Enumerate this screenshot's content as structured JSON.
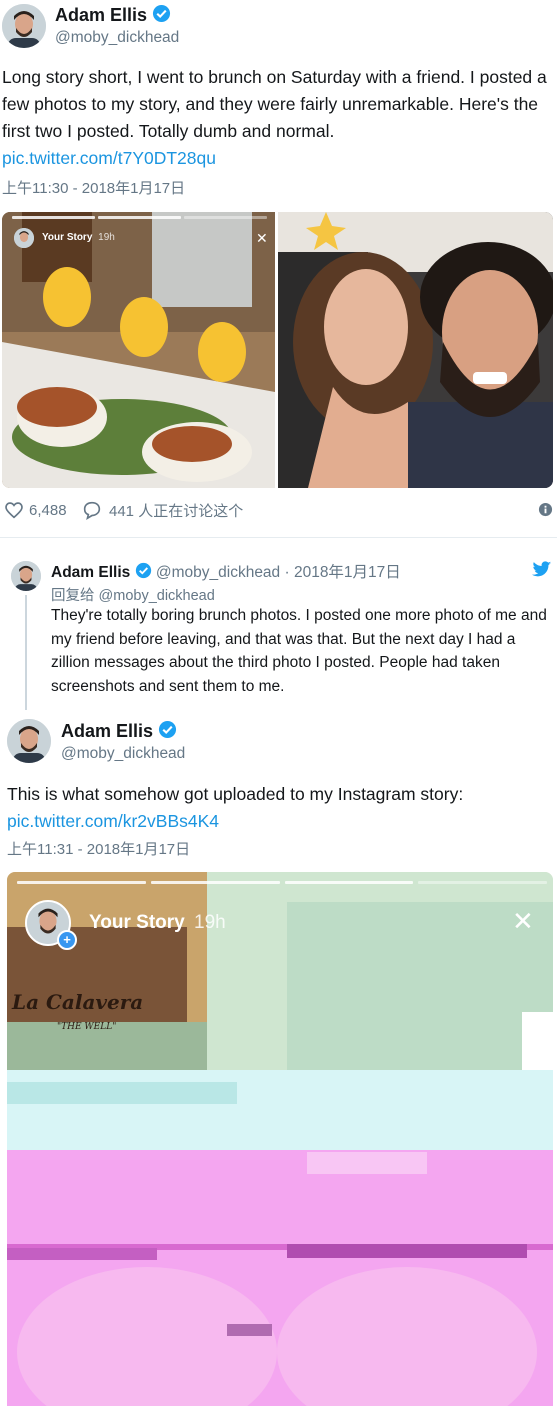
{
  "tweet1": {
    "display_name": "Adam Ellis",
    "handle": "@moby_dickhead",
    "text": "Long story short, I went to brunch on Saturday with a friend. I posted a few photos to my story, and they were fairly unremarkable. Here's the first two I posted. Totally dumb and normal.",
    "link": "pic.twitter.com/t7Y0DT28qu",
    "timestamp": "上午11:30 - 2018年1月17日",
    "story_label": "Your Story",
    "story_age": "19h",
    "likes": "6,488",
    "replies": "441 人正在讨论这个"
  },
  "reply": {
    "display_name": "Adam Ellis",
    "handle_date": "@moby_dickhead · 2018年1月17日",
    "reply_to": "回复给 @moby_dickhead",
    "text": "They're totally boring brunch photos. I posted one more photo of me and my friend before leaving, and that was that. But the next day I had a zillion messages about the third photo I posted. People had taken screenshots and sent them to me."
  },
  "tweet2": {
    "display_name": "Adam Ellis",
    "handle": "@moby_dickhead",
    "text": "This is what somehow got uploaded to my Instagram story:",
    "link": "pic.twitter.com/kr2vBBs4K4",
    "timestamp": "上午11:31 - 2018年1月17日",
    "story_label": "Your Story",
    "story_age": "19h",
    "sign_text": "La Calavera",
    "sign_sub": "\"THE WELL\""
  },
  "colors": {
    "link": "#1b95e0",
    "verified": "#1da1f2",
    "muted": "#657786"
  }
}
